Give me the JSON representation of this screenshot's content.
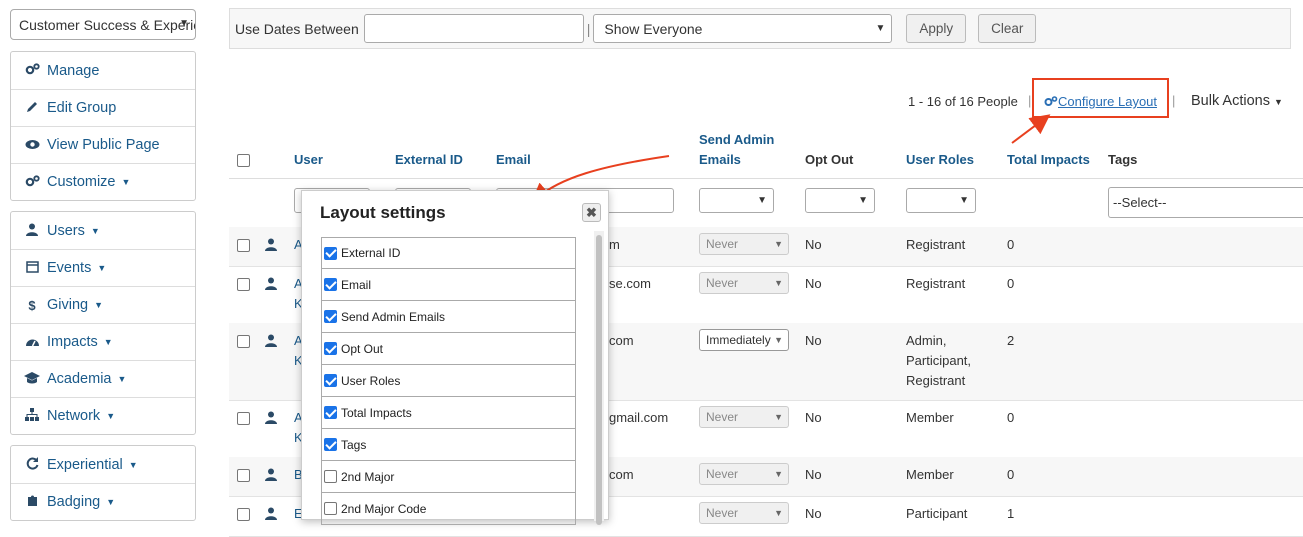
{
  "sidebar": {
    "group_select": "Customer Success & Experience",
    "box1": [
      {
        "label": "Manage",
        "icon": "cogs-icon"
      },
      {
        "label": "Edit Group",
        "icon": "pencil-icon"
      },
      {
        "label": "View Public Page",
        "icon": "eye-icon"
      },
      {
        "label": "Customize",
        "icon": "cogs-icon",
        "dropdown": true
      }
    ],
    "box2": [
      {
        "label": "Users",
        "icon": "user-icon"
      },
      {
        "label": "Events",
        "icon": "calendar-icon"
      },
      {
        "label": "Giving",
        "icon": "dollar-icon"
      },
      {
        "label": "Impacts",
        "icon": "tachometer-icon"
      },
      {
        "label": "Academia",
        "icon": "graduation-cap-icon"
      },
      {
        "label": "Network",
        "icon": "sitemap-icon"
      }
    ],
    "box3": [
      {
        "label": "Experiential",
        "icon": "refresh-icon"
      },
      {
        "label": "Badging",
        "icon": "puzzle-icon"
      }
    ]
  },
  "filterbar": {
    "dates_label": "Use Dates Between",
    "date_value": "",
    "pipe": "|",
    "show_select": "Show Everyone",
    "apply": "Apply",
    "clear": "Clear"
  },
  "toolbar": {
    "count": "1 - 16 of 16 People",
    "pipe": "|",
    "configure_layout": "Configure Layout",
    "bulk_actions": "Bulk Actions"
  },
  "table": {
    "headers": {
      "user": "User",
      "external_id": "External ID",
      "email": "Email",
      "send_admin_emails_1": "Send Admin",
      "send_admin_emails_2": "Emails",
      "opt_out": "Opt Out",
      "user_roles": "User Roles",
      "total_impacts": "Total Impacts",
      "tags": "Tags"
    },
    "tags_filter": "--Select--",
    "rows": [
      {
        "user": "A",
        "user2": "",
        "email": "m",
        "freq": "Never",
        "opt_out": "No",
        "roles": [
          "Registrant"
        ],
        "impacts": "0"
      },
      {
        "user": "A",
        "user2": "K",
        "email": "se.com",
        "freq": "Never",
        "opt_out": "No",
        "roles": [
          "Registrant"
        ],
        "impacts": "0"
      },
      {
        "user": "A",
        "user2": "K",
        "email": "com",
        "freq": "Immediately",
        "opt_out": "No",
        "roles": [
          "Admin,",
          "Participant,",
          "Registrant"
        ],
        "impacts": "2"
      },
      {
        "user": "A",
        "user2": "K",
        "email": "gmail.com",
        "freq": "Never",
        "opt_out": "No",
        "roles": [
          "Member"
        ],
        "impacts": "0"
      },
      {
        "user": "B",
        "user2": "",
        "email": "com",
        "freq": "Never",
        "opt_out": "No",
        "roles": [
          "Member"
        ],
        "impacts": "0"
      },
      {
        "user": "E",
        "user2": "",
        "email": "",
        "freq": "Never",
        "opt_out": "No",
        "roles": [
          "Participant"
        ],
        "impacts": "1"
      }
    ]
  },
  "popup": {
    "title": "Layout settings",
    "close": "✖",
    "items": [
      {
        "label": "External ID",
        "checked": true
      },
      {
        "label": "Email",
        "checked": true
      },
      {
        "label": "Send Admin Emails",
        "checked": true
      },
      {
        "label": "Opt Out",
        "checked": true
      },
      {
        "label": "User Roles",
        "checked": true
      },
      {
        "label": "Total Impacts",
        "checked": true
      },
      {
        "label": "Tags",
        "checked": true
      },
      {
        "label": "2nd Major",
        "checked": false
      },
      {
        "label": "2nd Major Code",
        "checked": false
      }
    ]
  },
  "colors": {
    "accent": "#1a5a8a",
    "highlight": "#e8401f",
    "check": "#1a73e8"
  }
}
